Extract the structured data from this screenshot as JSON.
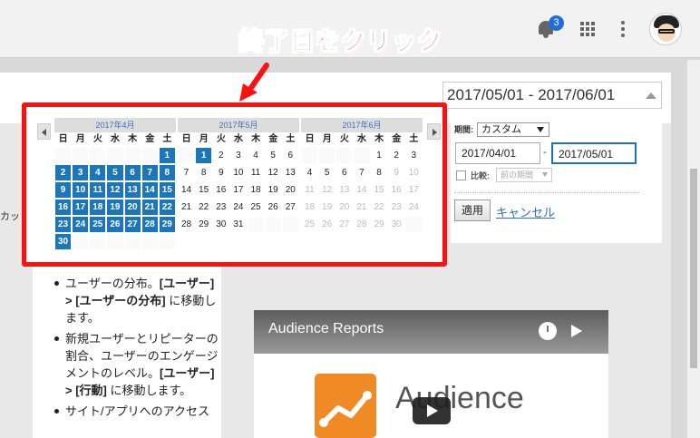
{
  "annotation": {
    "title": "終了日をクリック"
  },
  "topbar": {
    "notification_count": "3"
  },
  "side": {
    "cut_label": "カッ"
  },
  "date_range": {
    "text": "2017/05/01 - 2017/06/01"
  },
  "controls": {
    "period_label": "期間:",
    "period_value": "カスタム",
    "start_date": "2017/04/01",
    "dash": "-",
    "end_date": "2017/05/01",
    "compare_label": "比較:",
    "compare_value": "前の期間",
    "apply_label": "適用",
    "cancel_label": "キャンセル"
  },
  "calendar": {
    "weekdays": [
      "日",
      "月",
      "火",
      "水",
      "木",
      "金",
      "土"
    ],
    "months": [
      {
        "title": "2017年4月",
        "offset": 6,
        "days": 30,
        "selected": [
          1,
          30
        ],
        "future_after": null
      },
      {
        "title": "2017年5月",
        "offset": 1,
        "days": 31,
        "selected": [
          1,
          1
        ],
        "future_after": null
      },
      {
        "title": "2017年6月",
        "offset": 4,
        "days": 30,
        "selected": null,
        "future_after": 8
      }
    ]
  },
  "content": {
    "bullets": [
      {
        "parts": [
          {
            "t": "ユーザーの分布。"
          },
          {
            "t": "[ユーザー] > [ユーザーの分布]",
            "b": true
          },
          {
            "t": " に移動します。"
          }
        ]
      },
      {
        "parts": [
          {
            "t": "新規ユーザーとリピーターの割合、ユーザーのエンゲージメントのレベル。"
          },
          {
            "t": "[ユーザー] > [行動]",
            "b": true
          },
          {
            "t": " に移動します。"
          }
        ]
      },
      {
        "parts": [
          {
            "t": "サイト/アプリへのアクセス"
          }
        ]
      }
    ]
  },
  "video": {
    "title": "Audience Reports",
    "brand": "Audience"
  }
}
